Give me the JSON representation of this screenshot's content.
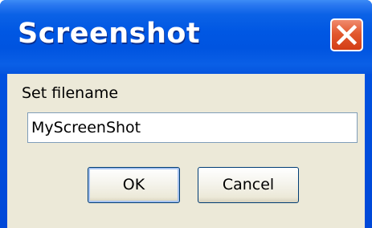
{
  "window": {
    "title": "Screenshot",
    "close_icon": "close-x-icon",
    "colors": {
      "titlebar": "#0054e0",
      "close_button": "#e2592f",
      "client_background": "#ece9d8",
      "input_border": "#7f9db9",
      "button_border": "#003c74"
    }
  },
  "form": {
    "filename_label": "Set filename",
    "filename_value": "MyScreenShot"
  },
  "buttons": {
    "ok_label": "OK",
    "cancel_label": "Cancel"
  }
}
